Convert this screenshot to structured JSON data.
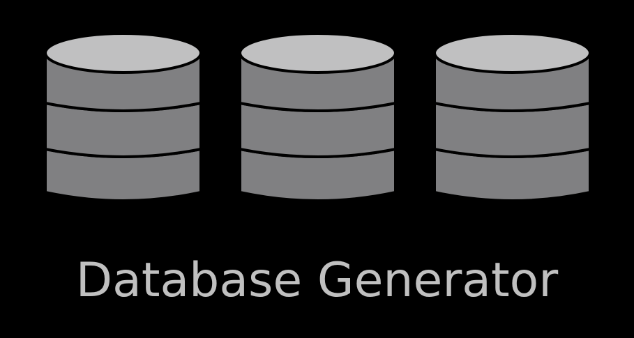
{
  "title": "Database Generator",
  "colors": {
    "background": "#000000",
    "cylinder_top": "#c0c0c1",
    "cylinder_body": "#808082",
    "cylinder_outline": "#000000",
    "title_text": "#c0c0c0"
  },
  "icons": [
    {
      "name": "database-icon"
    },
    {
      "name": "database-icon"
    },
    {
      "name": "database-icon"
    }
  ]
}
